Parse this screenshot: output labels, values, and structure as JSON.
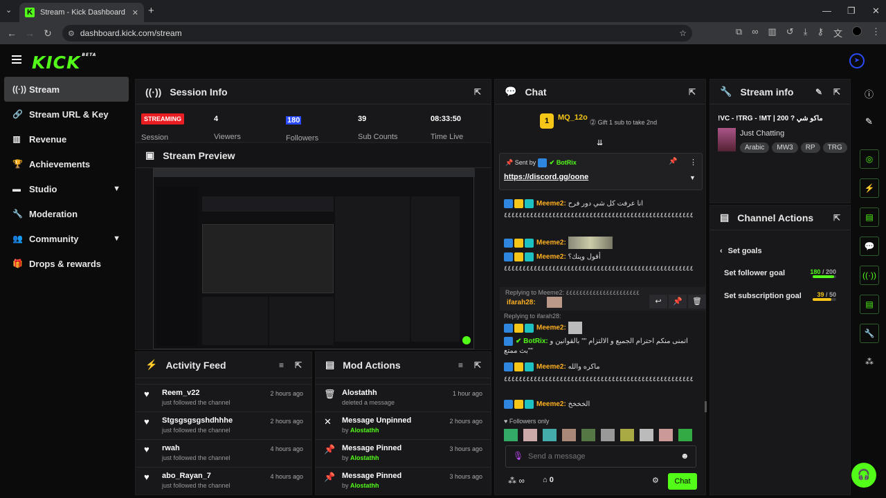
{
  "browser": {
    "tab_title": "Stream - Kick Dashboard",
    "url": "dashboard.kick.com/stream"
  },
  "app": {
    "logo": "KICK",
    "logo_sup": "BETA"
  },
  "sidebar": {
    "items": [
      {
        "label": "Stream",
        "icon": "broadcast-icon"
      },
      {
        "label": "Stream URL & Key",
        "icon": "link-icon"
      },
      {
        "label": "Revenue",
        "icon": "chart-icon"
      },
      {
        "label": "Achievements",
        "icon": "trophy-icon"
      },
      {
        "label": "Studio",
        "icon": "studio-icon"
      },
      {
        "label": "Moderation",
        "icon": "wrench-icon"
      },
      {
        "label": "Community",
        "icon": "community-icon"
      },
      {
        "label": "Drops & rewards",
        "icon": "gift-icon"
      }
    ]
  },
  "session": {
    "title": "Session Info",
    "status": "STREAMING",
    "status_label": "Session",
    "stats": [
      {
        "value": "4",
        "label": "Viewers"
      },
      {
        "value": "180",
        "label": "Followers"
      },
      {
        "value": "39",
        "label": "Sub Counts"
      },
      {
        "value": "08:33:50",
        "label": "Time Live"
      }
    ]
  },
  "preview": {
    "title": "Stream Preview"
  },
  "activity": {
    "title": "Activity Feed",
    "items": [
      {
        "name": "Reem_v22",
        "sub": "just followed the channel",
        "time": "2 hours ago"
      },
      {
        "name": "Stgsgsgsgshdhhhe",
        "sub": "just followed the channel",
        "time": "2 hours ago"
      },
      {
        "name": "rwah",
        "sub": "just followed the channel",
        "time": "4 hours ago"
      },
      {
        "name": "abo_Rayan_7",
        "sub": "just followed the channel",
        "time": "4 hours ago"
      }
    ]
  },
  "mod": {
    "title": "Mod Actions",
    "items": [
      {
        "name": "Alostathh",
        "sub": "deleted a message",
        "by": "",
        "time": "1 hour ago"
      },
      {
        "name": "Message Unpinned",
        "sub": "by ",
        "by": "Alostathh",
        "time": "2 hours ago"
      },
      {
        "name": "Message Pinned",
        "sub": "by ",
        "by": "Alostathh",
        "time": "3 hours ago"
      },
      {
        "name": "Message Pinned",
        "sub": "by ",
        "by": "Alostathh",
        "time": "3 hours ago"
      }
    ]
  },
  "chat": {
    "title": "Chat",
    "top_gifter": "MQ_12o",
    "top_count": "1",
    "gift_text": "Gift 1 sub to take 2nd",
    "pinned": {
      "sent_by": "Sent by",
      "user": "BotRix",
      "link": "https://discord.gg/oone"
    },
    "messages": [
      {
        "user": "Meeme2:",
        "text": "انا عرفت كل شي دور فرح"
      },
      {
        "user": "",
        "text": "٤٤٤٤٤٤٤٤٤٤٤٤٤٤٤٤٤٤٤٤٤٤٤٤٤٤٤٤٤٤٤٤٤٤٤٤٤٤٤٤٤٤٤٤٤٤٤٤٤٤٤٤٤٤٤٤٤٤٤٤٤٤"
      },
      {
        "user": "Meeme2:",
        "text": ""
      },
      {
        "user": "Meeme2:",
        "text": "أقول وينك؟"
      },
      {
        "user": "",
        "text": "٤٤٤٤٤٤٤٤٤٤٤٤٤٤٤٤٤٤٤٤٤٤٤٤٤٤٤٤٤٤٤٤٤٤٤٤٤٤٤٤٤٤٤٤٤٤٤٤٤٤٤٤٤٤٤٤٤٤٤٤٤٤"
      }
    ],
    "reply1": "Replying to Meeme2: ٤٤٤٤٤٤٤٤٤٤٤٤٤٤٤٤٤٤٤٤٤٤",
    "reply1_user": "ifarah28:",
    "reply2": "Replying to ifarah28:",
    "msg_after": [
      {
        "user": "Meeme2:",
        "text": ""
      },
      {
        "user": "BotRix:",
        "text": "اتمنى منكم احترام الجميع و الالتزام \"\" بالقوانين و بث ممتع\"\""
      },
      {
        "user": "Meeme2:",
        "text": "ماكره والله"
      },
      {
        "user": "",
        "text": "٤٤٤٤٤٤٤٤٤٤٤٤٤٤٤٤٤٤٤٤٤٤٤٤٤٤٤٤٤٤٤٤٤٤٤٤٤٤٤٤٤٤٤٤٤٤٤٤٤٤٤٤٤٤٤٤٤٤٤٤٤٤"
      },
      {
        "user": "Meeme2:",
        "text": "الخخخخ"
      }
    ],
    "followers_only": "Followers only",
    "placeholder": "Send a message",
    "points": "0",
    "send": "Chat"
  },
  "streaminfo": {
    "title": "Stream info",
    "stream_title": "!VC - !TRG - !MT | 200 ? ماكو شي",
    "category": "Just Chatting",
    "tags": [
      "Arabic",
      "MW3",
      "RP",
      "TRG"
    ]
  },
  "channel": {
    "title": "Channel Actions",
    "back": "Set goals",
    "goals": [
      {
        "label": "Set follower goal",
        "value": "180",
        "total": "/ 200",
        "fill": 0.9
      },
      {
        "label": "Set subscription goal",
        "value": "39",
        "total": "/ 50",
        "fill": 0.78
      }
    ]
  },
  "colors": {
    "accent": "#53fc18",
    "panel": "#18181b",
    "streaming": "#e81e23"
  }
}
